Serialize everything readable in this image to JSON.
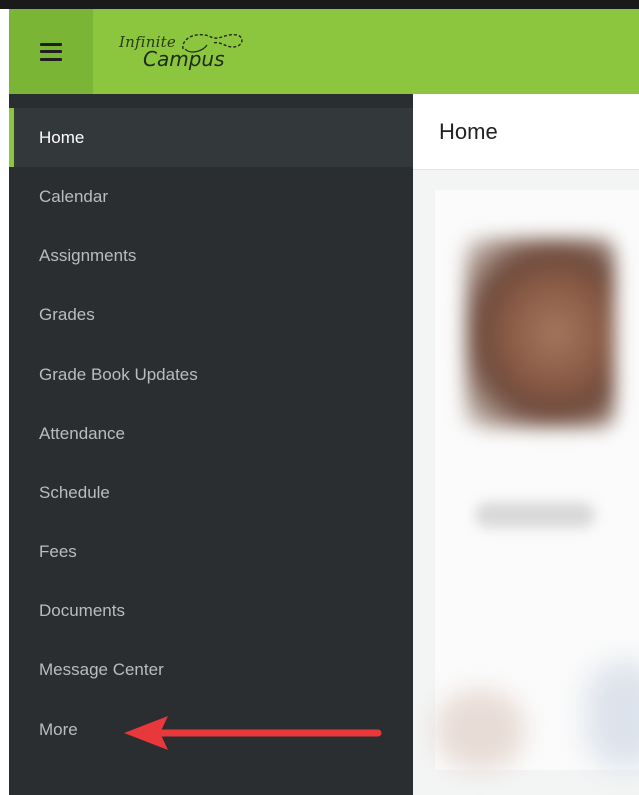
{
  "header": {
    "menu_icon": "hamburger-menu-icon",
    "logo": {
      "line1": "Infinite",
      "line2": "Campus"
    },
    "brand_color": "#8cc63f"
  },
  "sidebar": {
    "items": [
      {
        "label": "Home",
        "active": true
      },
      {
        "label": "Calendar",
        "active": false
      },
      {
        "label": "Assignments",
        "active": false
      },
      {
        "label": "Grades",
        "active": false
      },
      {
        "label": "Grade Book Updates",
        "active": false
      },
      {
        "label": "Attendance",
        "active": false
      },
      {
        "label": "Schedule",
        "active": false
      },
      {
        "label": "Fees",
        "active": false
      },
      {
        "label": "Documents",
        "active": false
      },
      {
        "label": "Message Center",
        "active": false
      },
      {
        "label": "More",
        "active": false
      }
    ],
    "background_color": "#2a2e30",
    "active_indicator_color": "#8cc63f"
  },
  "main": {
    "title": "Home"
  },
  "annotation": {
    "arrow_color": "#e8383b",
    "points_to": "More"
  }
}
